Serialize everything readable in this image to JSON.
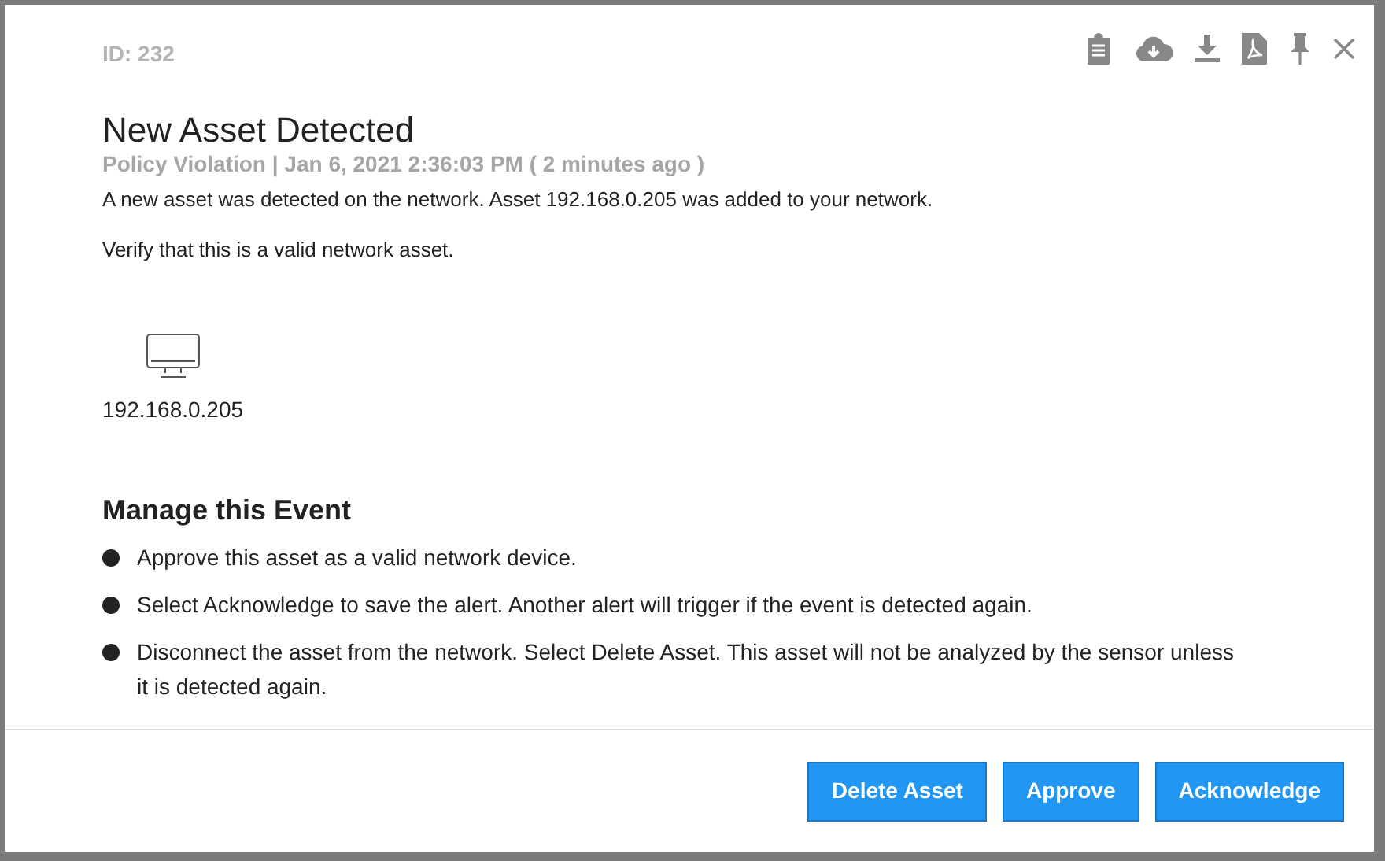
{
  "dialog": {
    "id_label": "ID: 232",
    "toolbar": [
      {
        "kind": "clipboard"
      },
      {
        "kind": "cloud-download"
      },
      {
        "kind": "download"
      },
      {
        "kind": "pdf"
      },
      {
        "kind": "pin"
      },
      {
        "kind": "close"
      }
    ],
    "title": "New Asset Detected",
    "meta": "Policy Violation | Jan 6, 2021 2:36:03 PM ( 2 minutes ago )",
    "paragraphs": [
      "A new asset was detected on the network. Asset 192.168.0.205 was added to your network.",
      "Verify that this is a valid network asset."
    ],
    "asset": {
      "address": "192.168.0.205"
    },
    "manage": {
      "heading": "Manage this Event",
      "items": [
        "Approve this asset as a valid network device.",
        "Select Acknowledge to save the alert. Another alert will trigger if the event is detected again.",
        "Disconnect the asset from the network. Select Delete Asset. This asset will not be analyzed by the sensor unless it is detected again."
      ]
    },
    "buttons": [
      "Delete Asset",
      "Approve",
      "Acknowledge"
    ]
  }
}
